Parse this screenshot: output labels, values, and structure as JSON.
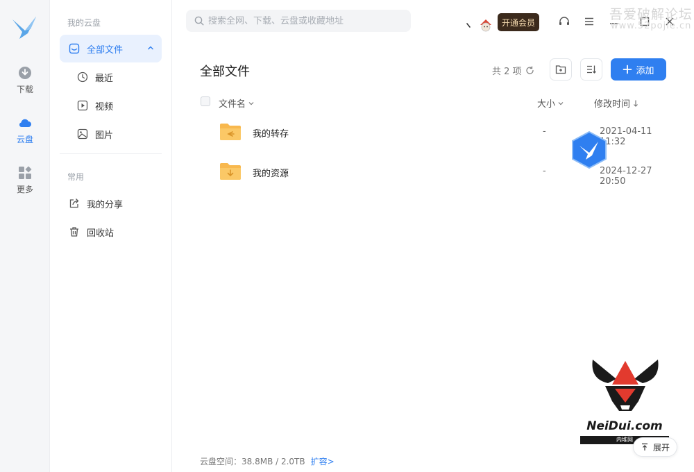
{
  "colors": {
    "accent": "#2f7ff0",
    "vip_bg": "#3b2a1c",
    "vip_text": "#f3d9ae",
    "folder": "#f8b84e"
  },
  "rail": {
    "items": [
      {
        "label": "下载",
        "icon": "download-icon"
      },
      {
        "label": "云盘",
        "icon": "cloud-icon"
      },
      {
        "label": "更多",
        "icon": "grid-icon"
      }
    ]
  },
  "sidebar": {
    "section1": "我的云盘",
    "all_files": "全部文件",
    "sub_items": [
      "最近",
      "视频",
      "图片"
    ],
    "section2": "常用",
    "common_items": [
      "我的分享",
      "回收站"
    ]
  },
  "topbar": {
    "search_placeholder": "搜索全网、下载、云盘或收藏地址",
    "vip_label": "开通会员",
    "watermark": "吾爱破解论坛",
    "watermark_url": "www.52pojie.cn"
  },
  "main": {
    "title": "全部文件",
    "count": "共 2 项",
    "add_label": "添加",
    "columns": {
      "name": "文件名",
      "size": "大小",
      "modified": "修改时间"
    },
    "rows": [
      {
        "name": "我的转存",
        "size": "-",
        "modified": "2021-04-11 11:32"
      },
      {
        "name": "我的资源",
        "size": "-",
        "modified": "2024-12-27 20:50"
      }
    ]
  },
  "footer": {
    "space_label": "云盘空间：38.8MB / 2.0TB",
    "expand_link": "扩容>",
    "expand_button": "展开"
  },
  "brand": {
    "site": "NeiDui.com",
    "site_cn": "内堆网"
  }
}
